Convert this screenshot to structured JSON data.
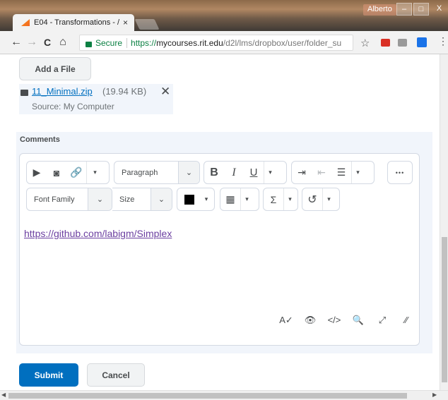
{
  "browser": {
    "tab_title": "E04 - Transformations - /",
    "tab_close": "×",
    "user": "Alberto",
    "win_min": "–",
    "win_max": "□",
    "win_close": "X",
    "back": "←",
    "forward": "→",
    "reload": "C",
    "home": "⌂",
    "secure_label": "Secure",
    "url_scheme": "https://",
    "url_host": "mycourses.rit.edu",
    "url_path": "/d2l/lms/dropbox/user/folder_su",
    "star": "☆",
    "menu": "⋮"
  },
  "upload": {
    "add_file_label": "Add a File",
    "file_name": "11_Minimal.zip",
    "file_size": "(19.94 KB)",
    "remove": "✕",
    "source": "Source: My Computer"
  },
  "comments": {
    "label": "Comments",
    "paragraph_select": "Paragraph",
    "font_family_select": "Font Family",
    "size_select": "Size",
    "link_text": "https://github.com/labigm/Simplex"
  },
  "toolbar_glyphs": {
    "video": "▶",
    "camera": "◙",
    "link": "🔗",
    "caret": "▾",
    "chevron": "⌄",
    "bold": "B",
    "italic": "I",
    "underline": "U",
    "indent": "⇥",
    "outdent": "⇤",
    "list": "☰",
    "more": "•••",
    "table": "▦",
    "sigma": "Σ",
    "undo": "↺",
    "spellcheck": "A✓",
    "preview": "👁",
    "source": "</>",
    "find": "🔍",
    "fullscreen": "⤢",
    "resize": "⁄⁄"
  },
  "actions": {
    "submit_label": "Submit",
    "cancel_label": "Cancel"
  },
  "colors": {
    "primary": "#006fbf",
    "panel_bg": "#f1f5fb",
    "link_visited": "#6b3fa0"
  }
}
